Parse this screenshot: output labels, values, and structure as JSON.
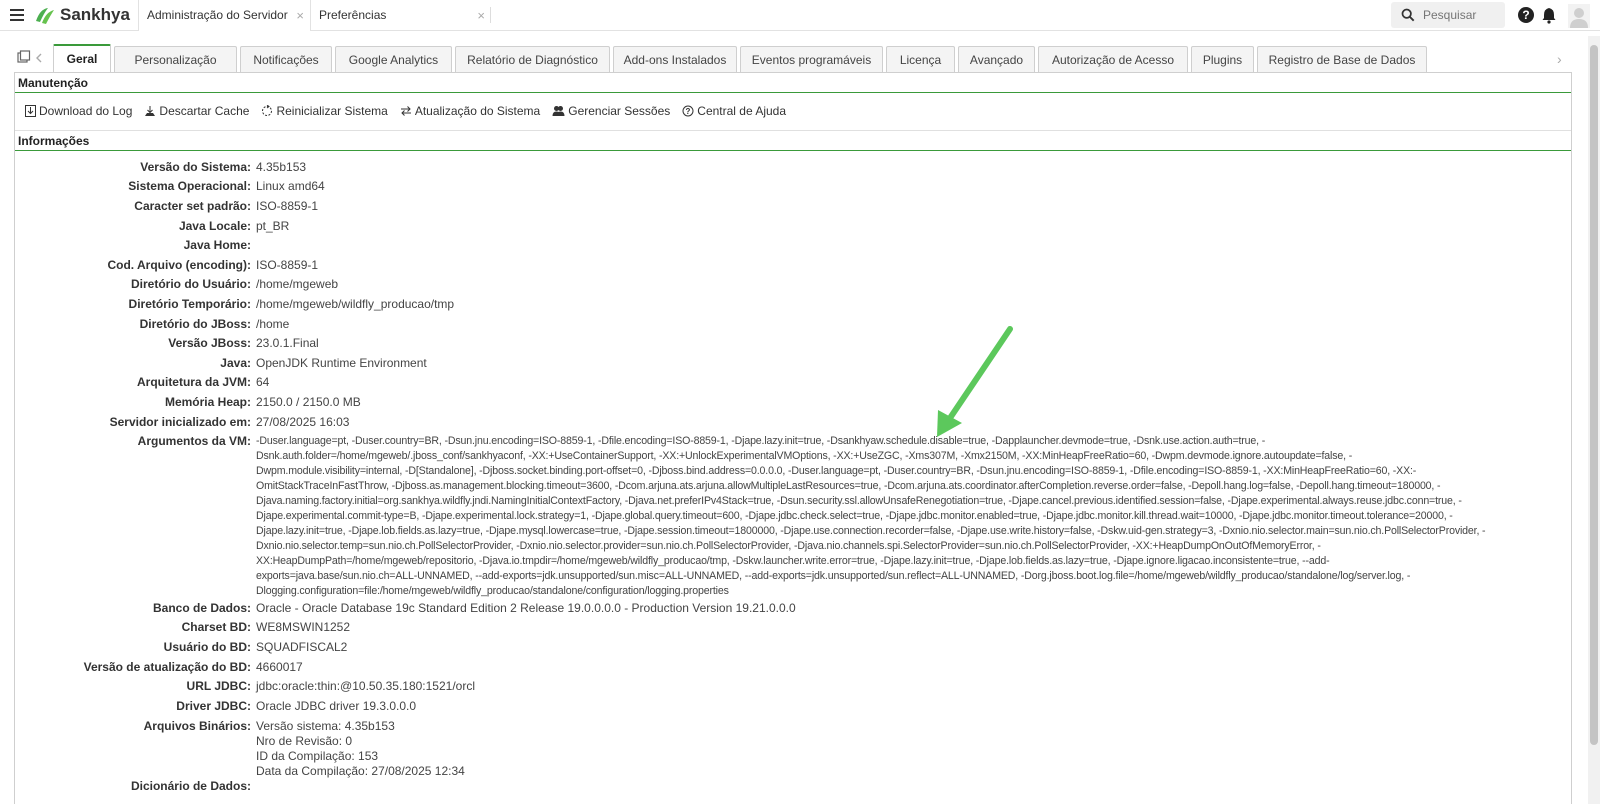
{
  "topbar": {
    "brand": "Sankhya",
    "tabs": [
      {
        "label": "Administração do Servidor",
        "close": "×"
      },
      {
        "label": "Preferências",
        "close": "×"
      }
    ],
    "search_placeholder": "Pesquisar"
  },
  "subtabs": [
    "Geral",
    "Personalização",
    "Notificações",
    "Google Analytics",
    "Relatório de Diagnóstico",
    "Add-ons Instalados",
    "Eventos programáveis",
    "Licença",
    "Avançado",
    "Autorização de Acesso",
    "Plugins",
    "Registro de Base de Dados"
  ],
  "manutencao": {
    "title": "Manutenção",
    "actions": [
      "Download do Log",
      "Descartar Cache",
      "Reinicializar Sistema",
      "Atualização do Sistema",
      "Gerenciar Sessões",
      "Central de Ajuda"
    ]
  },
  "informacoes": {
    "title": "Informações",
    "rows": [
      {
        "label": "Versão do Sistema:",
        "value": "4.35b153"
      },
      {
        "label": "Sistema Operacional:",
        "value": "Linux amd64"
      },
      {
        "label": "Caracter set padrão:",
        "value": "ISO-8859-1"
      },
      {
        "label": "Java Locale:",
        "value": "pt_BR"
      },
      {
        "label": "Java Home:",
        "value": ""
      },
      {
        "label": "Cod. Arquivo (encoding):",
        "value": "ISO-8859-1"
      },
      {
        "label": "Diretório do Usuário:",
        "value": "/home/mgeweb"
      },
      {
        "label": "Diretório Temporário:",
        "value": "/home/mgeweb/wildfly_producao/tmp"
      },
      {
        "label": "Diretório do JBoss:",
        "value": "/home"
      },
      {
        "label": "Versão JBoss:",
        "value": "23.0.1.Final"
      },
      {
        "label": "Java:",
        "value": "OpenJDK Runtime Environment"
      },
      {
        "label": "Arquitetura da JVM:",
        "value": "64"
      },
      {
        "label": "Memória Heap:",
        "value": "2150.0 / 2150.0 MB"
      },
      {
        "label": "Servidor inicializado em:",
        "value": "27/08/2025 16:03"
      },
      {
        "label": "Argumentos da VM:",
        "value": "-Duser.language=pt, -Duser.country=BR, -Dsun.jnu.encoding=ISO-8859-1, -Dfile.encoding=ISO-8859-1, -Djape.lazy.init=true, -Dsankhyaw.schedule.disable=true, -Dapplauncher.devmode=true, -Dsnk.use.action.auth=true, -\nDsnk.auth.folder=/home/mgeweb/.jboss_conf/sankhyaconf, -XX:+UseContainerSupport, -XX:+UnlockExperimentalVMOptions, -XX:+UseZGC, -Xms307M, -Xmx2150M, -XX:MinHeapFreeRatio=60, -Dwpm.devmode.ignore.autoupdate=false, -\nDwpm.module.visibility=internal, -D[Standalone], -Djboss.socket.binding.port-offset=0, -Djboss.bind.address=0.0.0.0, -Duser.language=pt, -Duser.country=BR, -Dsun.jnu.encoding=ISO-8859-1, -Dfile.encoding=ISO-8859-1, -XX:MinHeapFreeRatio=60, -XX:-\nOmitStackTraceInFastThrow, -Djboss.as.management.blocking.timeout=3600, -Dcom.arjuna.ats.arjuna.allowMultipleLastResources=true, -Dcom.arjuna.ats.coordinator.afterCompletion.reverse.order=false, -Depoll.hang.log=false, -Depoll.hang.timeout=180000, -\nDjava.naming.factory.initial=org.sankhya.wildfly.jndi.NamingInitialContextFactory, -Djava.net.preferIPv4Stack=true, -Dsun.security.ssl.allowUnsafeRenegotiation=true, -Djape.cancel.previous.identified.session=false, -Djape.experimental.always.reuse.jdbc.conn=true, -\nDjape.experimental.commit-type=B, -Djape.experimental.lock.strategy=1, -Djape.global.query.timeout=600, -Djape.jdbc.check.select=true, -Djape.jdbc.monitor.enabled=true, -Djape.jdbc.monitor.kill.thread.wait=10000, -Djape.jdbc.monitor.timeout.tolerance=20000, -\nDjape.lazy.init=true, -Djape.lob.fields.as.lazy=true, -Djape.mysql.lowercase=true, -Djape.session.timeout=1800000, -Djape.use.connection.recorder=false, -Djape.use.write.history=false, -Dskw.uid-gen.strategy=3, -Dxnio.nio.selector.main=sun.nio.ch.PollSelectorProvider, -\nDxnio.nio.selector.temp=sun.nio.ch.PollSelectorProvider, -Dxnio.nio.selector.provider=sun.nio.ch.PollSelectorProvider, -Djava.nio.channels.spi.SelectorProvider=sun.nio.ch.PollSelectorProvider, -XX:+HeapDumpOnOutOfMemoryError, -\nXX:HeapDumpPath=/home/mgeweb/repositorio, -Djava.io.tmpdir=/home/mgeweb/wildfly_producao/tmp, -Dskw.launcher.write.error=true, -Djape.lazy.init=true, -Djape.lob.fields.as.lazy=true, -Djape.ignore.ligacao.inconsistente=true, --add-\nexports=java.base/sun.nio.ch=ALL-UNNAMED, --add-exports=jdk.unsupported/sun.misc=ALL-UNNAMED, --add-exports=jdk.unsupported/sun.reflect=ALL-UNNAMED, -Dorg.jboss.boot.log.file=/home/mgeweb/wildfly_producao/standalone/log/server.log, -\nDlogging.configuration=file:/home/mgeweb/wildfly_producao/standalone/configuration/logging.properties"
      },
      {
        "label": "Banco de Dados:",
        "value": "Oracle - Oracle Database 19c Standard Edition 2 Release 19.0.0.0.0 - Production Version 19.21.0.0.0"
      },
      {
        "label": "Charset BD:",
        "value": "WE8MSWIN1252"
      },
      {
        "label": "Usuário do BD:",
        "value": "SQUADFISCAL2"
      },
      {
        "label": "Versão de atualização do BD:",
        "value": "4660017"
      },
      {
        "label": "URL JDBC:",
        "value": "jdbc:oracle:thin:@10.50.35.180:1521/orcl"
      },
      {
        "label": "Driver JDBC:",
        "value": "Oracle JDBC driver 19.3.0.0.0"
      },
      {
        "label": "Arquivos Binários:",
        "value": "Versão sistema: 4.35b153\nNro de Revisão: 0\nID da Compilação: 153\nData da Compilação: 27/08/2025 12:34"
      },
      {
        "label": "Dicionário de Dados:",
        "value": ""
      }
    ]
  },
  "colors": {
    "accent": "#3a9a3a",
    "brand": "#4caf50",
    "arrow": "#5cc85c"
  },
  "icons": [
    "menu-icon",
    "sankhya-logo-icon",
    "search-icon",
    "help-icon",
    "bell-icon",
    "user-avatar-icon",
    "window-icon",
    "chevron-left-icon",
    "chevron-right-icon",
    "download-icon",
    "cache-icon",
    "restart-icon",
    "update-icon",
    "sessions-icon",
    "help-circle-icon"
  ]
}
